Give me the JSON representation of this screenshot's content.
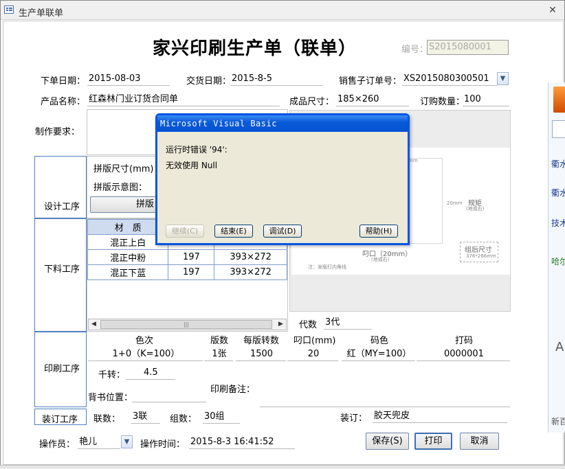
{
  "window": {
    "title": "生产单联单",
    "close_glyph": "✕"
  },
  "header": {
    "main_title": "家兴印刷生产单（联单）",
    "serial_label": "编号：",
    "serial_value": "S2015080001"
  },
  "order": {
    "order_date_label": "下单日期：",
    "order_date": "2015-08-03",
    "delivery_date_label": "交货日期：",
    "delivery_date": "2015-8-5",
    "sub_order_label": "销售子订单号：",
    "sub_order": "XS2015080300501",
    "product_label": "产品名称：",
    "product": "红森林门业订货合同单",
    "size_label": "成品尺寸：",
    "size": "185×260",
    "qty_label": "订购数量：",
    "qty": "100",
    "req_label": "制作要求："
  },
  "design": {
    "section_label": "设计工序",
    "imposition_size_label": "拼版尺寸(mm)",
    "imposition_diagram_label": "拼版示意图：",
    "imposition_button": "拼版"
  },
  "cutting": {
    "section_label": "下料工序",
    "columns": [
      "材　质",
      "",
      ""
    ],
    "rows": [
      {
        "material": "混正上白",
        "weight": "",
        "size": ""
      },
      {
        "material": "混正中粉",
        "weight": "197",
        "size": "393×272"
      },
      {
        "material": "混正下蓝",
        "weight": "197",
        "size": "393×272"
      }
    ]
  },
  "preview": {
    "label_gauge": "规矩",
    "label_gauge_sub": "(地或右)",
    "label_mouth": "叼口（20mm）",
    "label_mouth_sub": "(地或右)",
    "label_combined": "组后尺寸",
    "label_combined_sub": "376*266mm",
    "label_note": "注：发版打内角线",
    "label_dim1": "20mm",
    "label_dim2": "mm"
  },
  "print": {
    "section_label": "印刷工序",
    "generations_label": "代数",
    "generations": "3代",
    "col_colors": "色次",
    "col_plates": "版数",
    "col_per_plate": "每版转数",
    "col_mouth": "叼口(mm)",
    "col_code_color": "码色",
    "col_numbering": "打码",
    "colors": "1+0（K=100）",
    "plates": "1张",
    "per_plate": "1500",
    "mouth": "20",
    "code_color": "红（MY=100）",
    "numbering": "0000001",
    "kilo_label": "千转：",
    "kilo": "4.5",
    "back_pos_label": "背书位置：",
    "notes_label": "印刷备注："
  },
  "binding": {
    "section_label": "装订工序",
    "copies_label": "联数：",
    "copies": "3联",
    "groups_label": "组数：",
    "groups": "30组",
    "binding_label": "装订：",
    "binding": "胶天兜皮"
  },
  "footer": {
    "operator_label": "操作员：",
    "operator": "艳儿",
    "op_time_label": "操作时间：",
    "op_time": "2015-8-3 16:41:52",
    "save_button": "保存(S)",
    "print_button": "打印",
    "cancel_button": "取消"
  },
  "dialog": {
    "title": "Microsoft Visual Basic",
    "message1": "运行时错误 '94':",
    "message2": "无效使用 Null",
    "continue_button": "继续(C)",
    "end_button": "结束(E)",
    "debug_button": "调试(D)",
    "help_button": "帮助(H)"
  },
  "side_app": {
    "lines": [
      "衢水",
      "衢水",
      "技术",
      "哈尔",
      "新百"
    ],
    "glyph_a": "A"
  },
  "colors": {
    "section_border": "#4e7fbf",
    "dialog_title": "#0a5ad8",
    "dialog_body": "#ece9d8"
  }
}
